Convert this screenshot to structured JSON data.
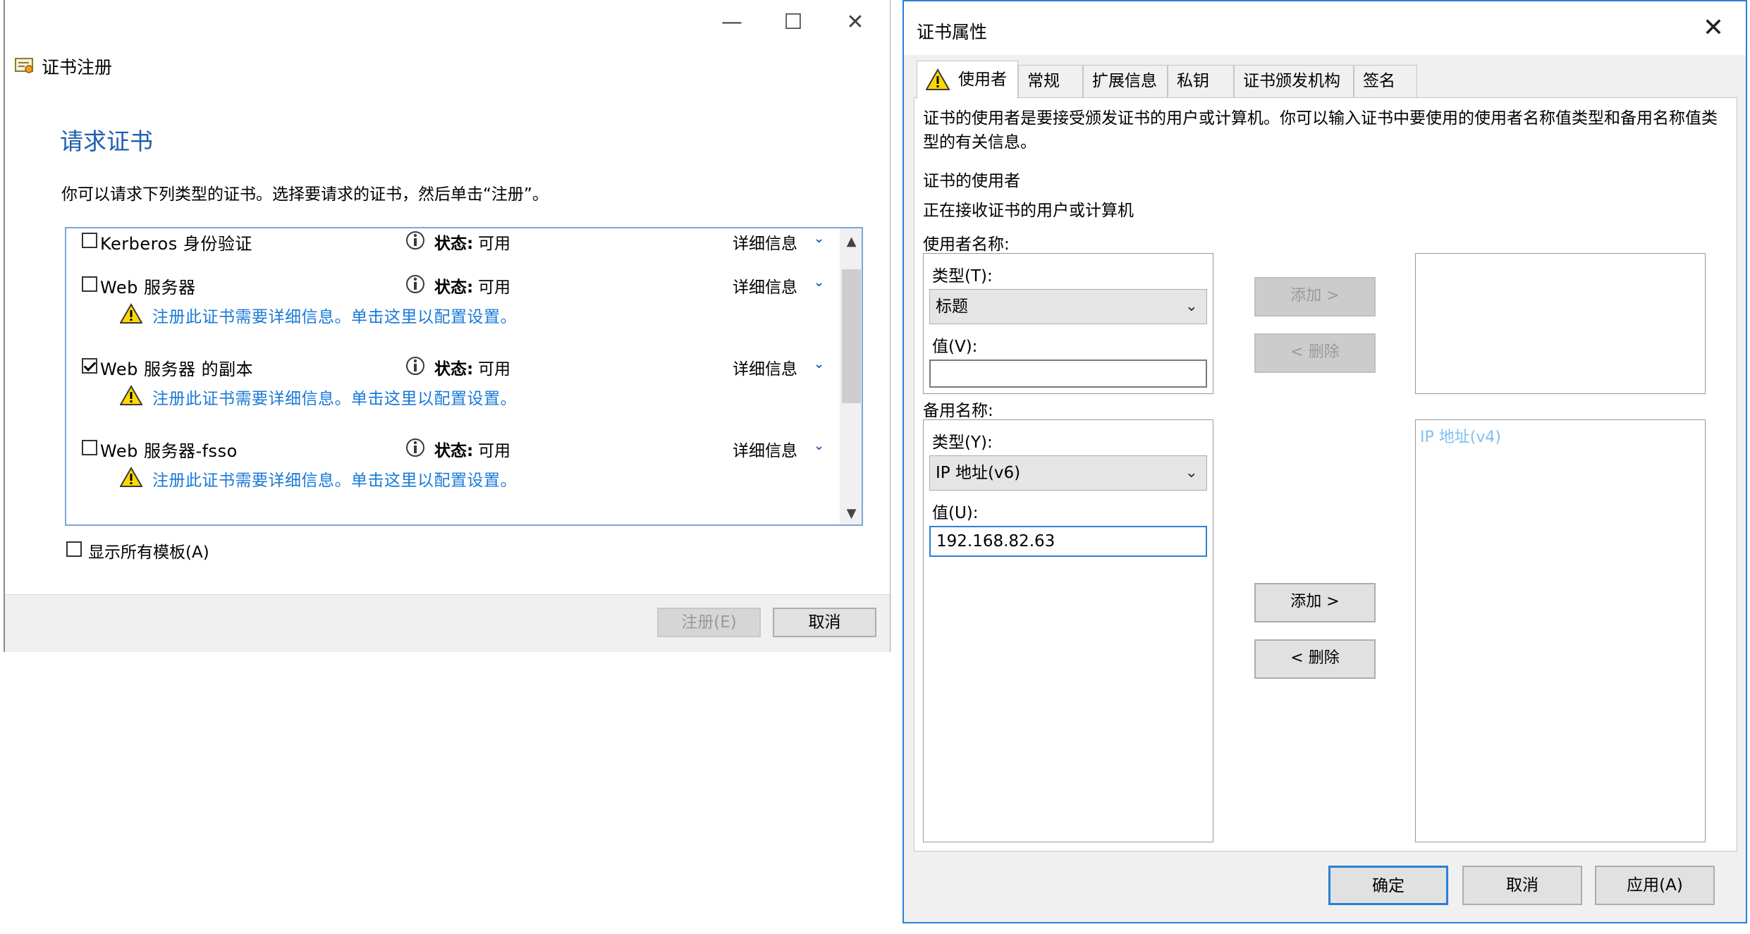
{
  "enroll": {
    "window_title": "证书注册",
    "heading": "请求证书",
    "description": "你可以请求下列类型的证书。选择要请求的证书，然后单击“注册”。",
    "templates": [
      {
        "name": "Kerberos 身份验证",
        "checked": false,
        "status_label": "状态:",
        "status_value": "可用",
        "details": "详细信息",
        "warning": ""
      },
      {
        "name": "Web 服务器",
        "checked": false,
        "status_label": "状态:",
        "status_value": "可用",
        "details": "详细信息",
        "warning": "注册此证书需要详细信息。单击这里以配置设置。"
      },
      {
        "name": "Web 服务器 的副本",
        "checked": true,
        "status_label": "状态:",
        "status_value": "可用",
        "details": "详细信息",
        "warning": "注册此证书需要详细信息。单击这里以配置设置。"
      },
      {
        "name": "Web 服务器-fsso",
        "checked": false,
        "status_label": "状态:",
        "status_value": "可用",
        "details": "详细信息",
        "warning": "注册此证书需要详细信息。单击这里以配置设置。"
      }
    ],
    "show_all_label": "显示所有模板(A)",
    "enroll_button": "注册(E)",
    "cancel_button": "取消"
  },
  "props": {
    "title": "证书属性",
    "tabs": [
      "使用者",
      "常规",
      "扩展信息",
      "私钥",
      "证书颁发机构",
      "签名"
    ],
    "intro": "证书的使用者是要接受颁发证书的用户或计算机。你可以输入证书中要使用的使用者名称值类型和备用名称值类型的有关信息。",
    "subject_heading": "证书的使用者",
    "subject_desc": "正在接收证书的用户或计算机",
    "subject_name_label": "使用者名称:",
    "subject_type_label": "类型(T):",
    "subject_type_value": "标题",
    "subject_value_label": "值(V):",
    "subject_value": "",
    "alt_name_label": "备用名称:",
    "alt_type_label": "类型(Y):",
    "alt_type_value": "IP 地址(v6)",
    "alt_value_label": "值(U):",
    "alt_value": "192.168.82.63",
    "add_button": "添加 >",
    "remove_button": "< 删除",
    "alt_list_item": "IP 地址(v4)",
    "ok_button": "确定",
    "cancel_button": "取消",
    "apply_button": "应用(A)"
  }
}
